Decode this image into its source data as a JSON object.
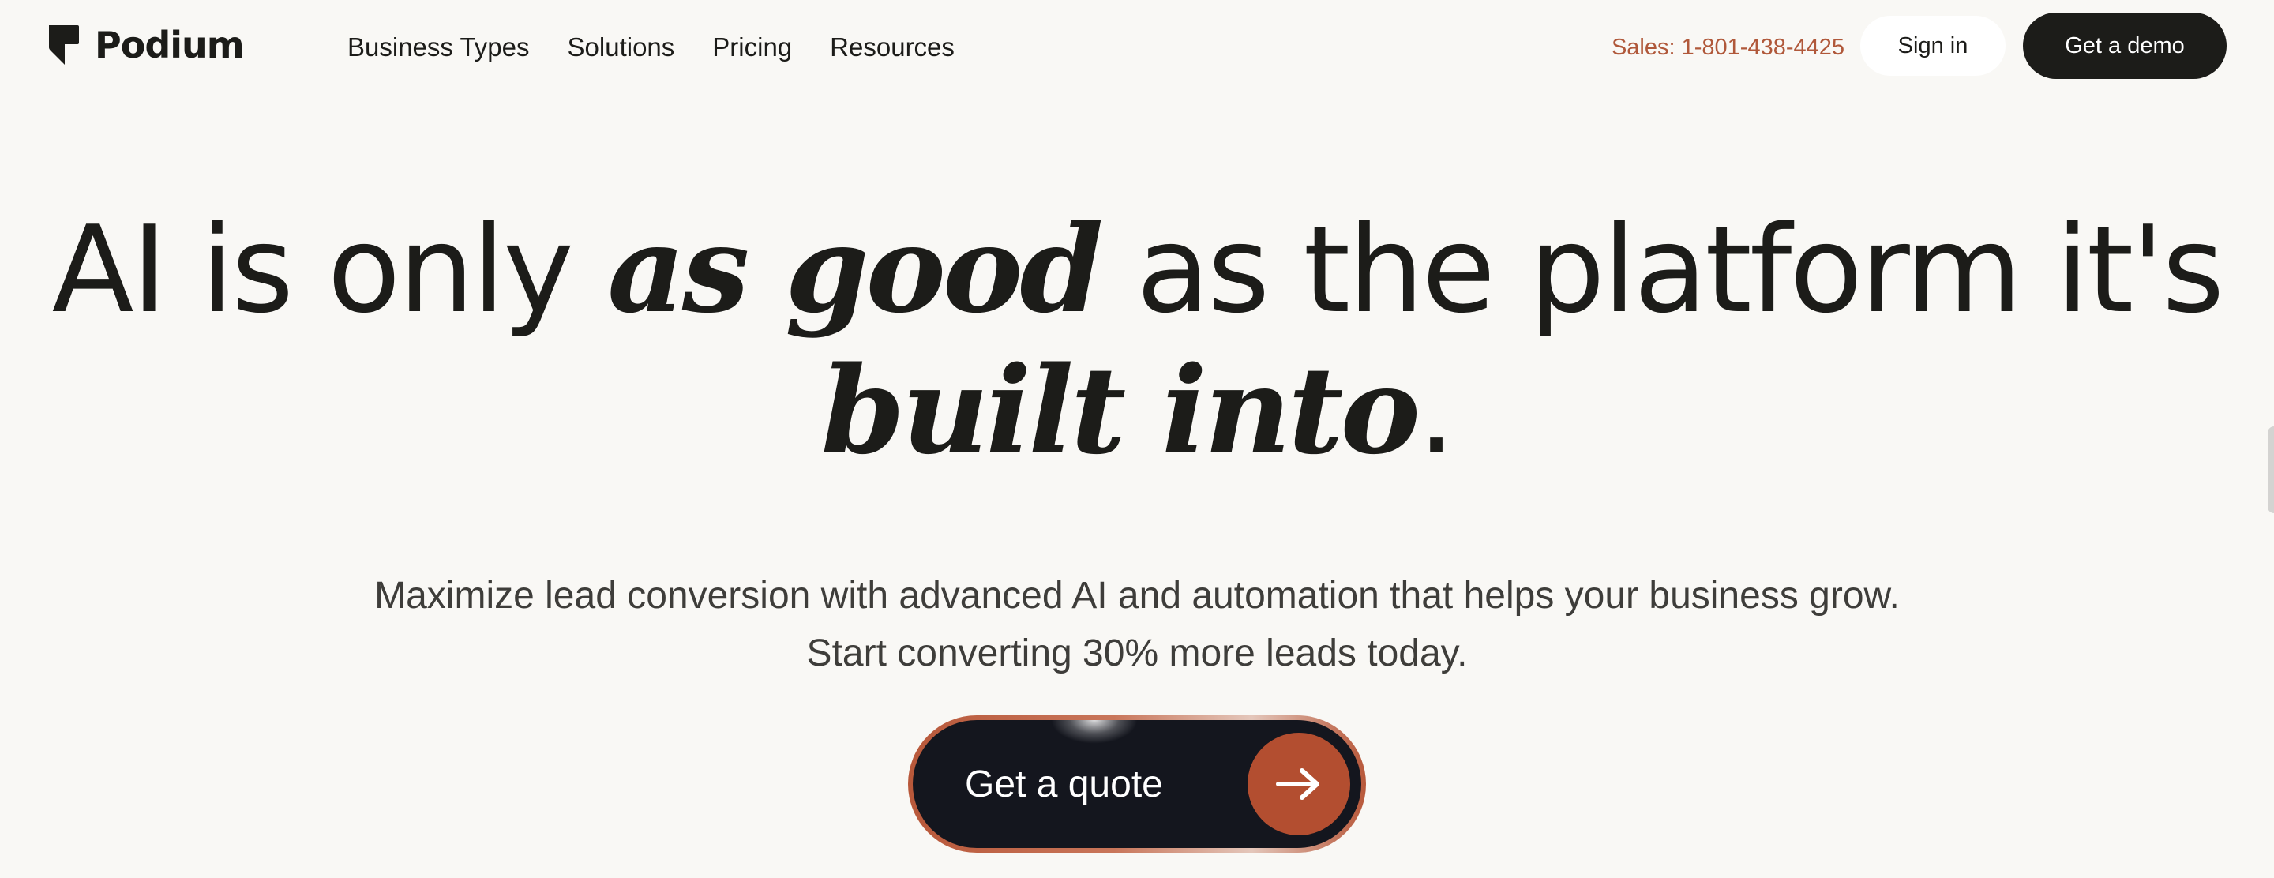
{
  "brand": {
    "name": "Podium",
    "accent_color": "#b34e30",
    "text_color": "#1c1c19",
    "background_color": "#f9f8f5"
  },
  "nav": {
    "items": [
      {
        "label": "Business Types"
      },
      {
        "label": "Solutions"
      },
      {
        "label": "Pricing"
      },
      {
        "label": "Resources"
      }
    ],
    "sales_phone": "Sales: 1-801-438-4425",
    "sign_in_label": "Sign in",
    "demo_label": "Get a demo"
  },
  "hero": {
    "title": {
      "line1_before": "AI is only ",
      "line1_emphasis": "as good",
      "line1_after": " as the platform it's",
      "line2_emphasis": "built into",
      "line2_after": "."
    },
    "subtitle_line1": "Maximize lead conversion with advanced AI and automation that helps your business grow.",
    "subtitle_line2": "Start converting 30% more leads today."
  },
  "cta": {
    "label": "Get a quote",
    "icon": "arrow-right-icon"
  }
}
